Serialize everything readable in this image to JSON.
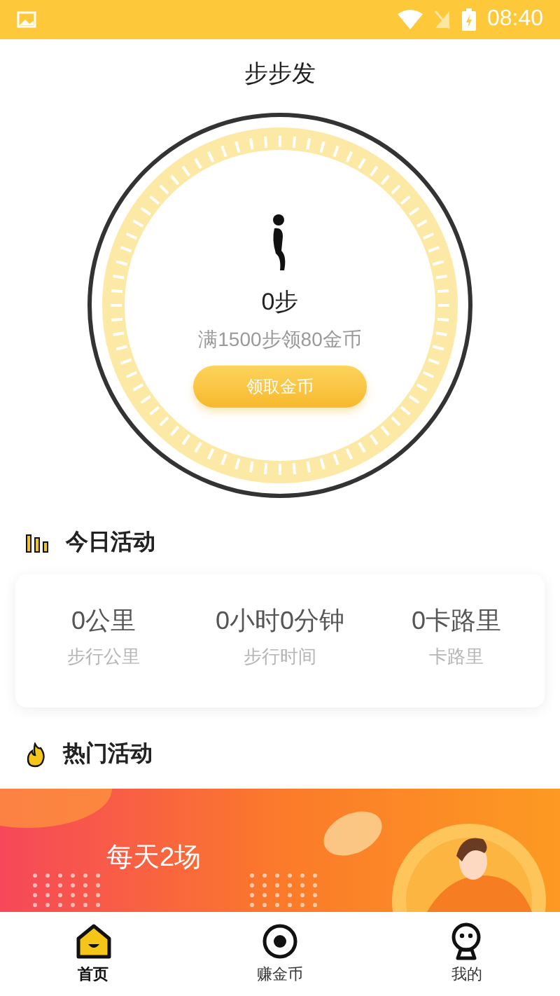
{
  "status_bar": {
    "time": "08:40"
  },
  "header": {
    "title": "步步发"
  },
  "pedometer": {
    "steps": "0步",
    "goal": "满1500步领80金币",
    "button": "领取金币"
  },
  "today": {
    "title": "今日活动",
    "stats": [
      {
        "value": "0公里",
        "label": "步行公里"
      },
      {
        "value": "0小时0分钟",
        "label": "步行时间"
      },
      {
        "value": "0卡路里",
        "label": "卡路里"
      }
    ]
  },
  "hot": {
    "title": "热门活动",
    "banner": {
      "kind": "picture",
      "caption": "每天2场"
    }
  },
  "tabs": [
    {
      "label": "首页",
      "kind": "home",
      "selected": true
    },
    {
      "label": "赚金币",
      "kind": "earn",
      "selected": false
    },
    {
      "label": "我的",
      "kind": "me",
      "selected": false
    }
  ]
}
